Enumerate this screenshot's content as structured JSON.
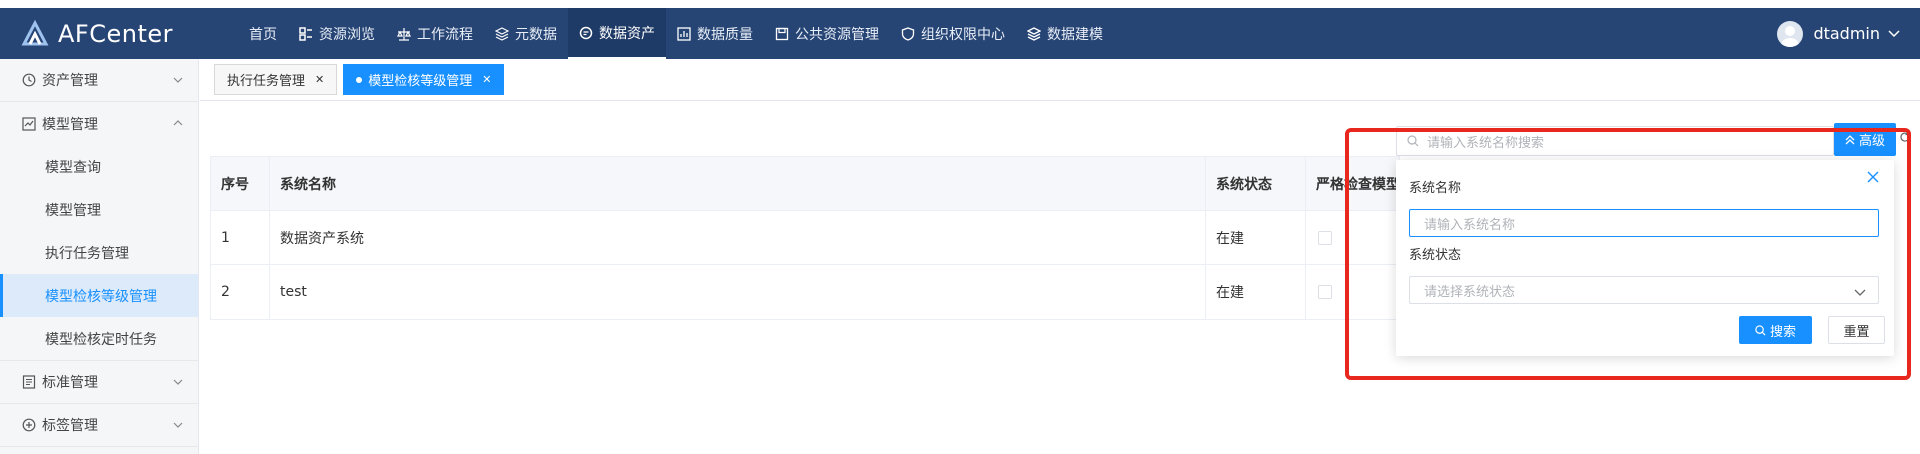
{
  "app": {
    "name": "AFCenter"
  },
  "nav": {
    "items": [
      {
        "label": "首页",
        "icon": "none"
      },
      {
        "label": "资源浏览",
        "icon": "grid-icon"
      },
      {
        "label": "工作流程",
        "icon": "scale-icon"
      },
      {
        "label": "元数据",
        "icon": "layers-icon"
      },
      {
        "label": "数据资产",
        "icon": "database-icon",
        "active": true
      },
      {
        "label": "数据质量",
        "icon": "chart-icon"
      },
      {
        "label": "公共资源管理",
        "icon": "save-icon"
      },
      {
        "label": "组织权限中心",
        "icon": "shield-icon"
      },
      {
        "label": "数据建模",
        "icon": "stack-icon"
      }
    ]
  },
  "user": {
    "name": "dtadmin"
  },
  "sidebar": {
    "groups": [
      {
        "label": "资产管理",
        "icon": "clock-icon",
        "expanded": false
      },
      {
        "label": "模型管理",
        "icon": "line-chart-icon",
        "expanded": true,
        "items": [
          "模型查询",
          "模型管理",
          "执行任务管理",
          "模型检核等级管理",
          "模型检核定时任务"
        ],
        "active_item": "模型检核等级管理"
      },
      {
        "label": "标准管理",
        "icon": "document-icon",
        "expanded": false
      },
      {
        "label": "标签管理",
        "icon": "plus-circle-icon",
        "expanded": false
      }
    ]
  },
  "tabs": [
    {
      "label": "执行任务管理",
      "active": false
    },
    {
      "label": "模型检核等级管理",
      "active": true
    }
  ],
  "search": {
    "placeholder": "请输入系统名称搜索",
    "advanced_label": "高级"
  },
  "table": {
    "headers": [
      "序号",
      "系统名称",
      "系统状态",
      "严格检查模型宗"
    ],
    "rows": [
      {
        "index": "1",
        "name": "数据资产系统",
        "status": "在建",
        "strict": false
      },
      {
        "index": "2",
        "name": "test",
        "status": "在建",
        "strict": false
      }
    ]
  },
  "filter_panel": {
    "system_name_label": "系统名称",
    "system_name_placeholder": "请输入系统名称",
    "system_status_label": "系统状态",
    "system_status_placeholder": "请选择系统状态",
    "search_button": "搜索",
    "reset_button": "重置"
  },
  "colors": {
    "header_bg": "#274574",
    "primary": "#1890ff",
    "annotation": "#e8281e"
  }
}
